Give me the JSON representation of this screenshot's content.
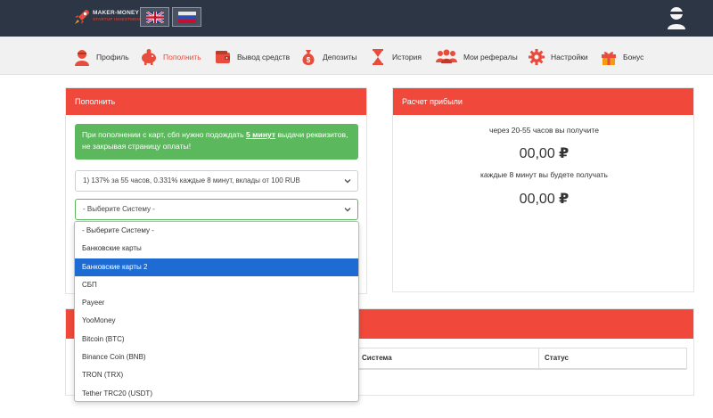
{
  "brand": {
    "name": "MAKER-MONEY",
    "tagline": "STARTUP INVESTMENTS"
  },
  "languages": [
    {
      "code": "en",
      "icon": "uk-flag-icon"
    },
    {
      "code": "ru",
      "icon": "ru-flag-icon"
    }
  ],
  "nav": {
    "items": [
      {
        "label": "Профиль",
        "icon": "user-icon"
      },
      {
        "label": "Пополнить",
        "icon": "piggy-bank-icon",
        "active": true
      },
      {
        "label": "Вывод средств",
        "icon": "wallet-icon"
      },
      {
        "label": "Депозиты",
        "icon": "money-bag-icon"
      },
      {
        "label": "История",
        "icon": "hourglass-icon"
      },
      {
        "label": "Мои рефералы",
        "icon": "people-icon"
      },
      {
        "label": "Настройки",
        "icon": "gear-icon"
      },
      {
        "label": "Бонус",
        "icon": "gift-icon"
      }
    ]
  },
  "deposit": {
    "title": "Пополнить",
    "alert_prefix": "При пополнении с карт, сбп нужно подождать ",
    "alert_bold": "5 минут",
    "alert_suffix": " выдачи реквизитов, не закрывая страницу оплаты!",
    "tariff_value": "1) 137% за 55 часов, 0.331% каждые 8 минут, вклады от 100 RUB",
    "system_value": "- Выберите Систему -",
    "system_options": [
      "- Выберите Систему -",
      "Банковские карты",
      "Банковские карты 2",
      "СБП",
      "Payeer",
      "YooMoney",
      "Bitcoin (BTC)",
      "Binance Coin (BNB)",
      "TRON (TRX)",
      "Tether TRC20 (USDT)"
    ],
    "system_selected_index": 2
  },
  "profit": {
    "title": "Расчет прибыли",
    "line1": "через 20-55 часов вы получите",
    "amount1": "00,00",
    "line2": "каждые 8 минут вы будете получать",
    "amount2": "00,00",
    "currency": "₽"
  },
  "history": {
    "columns": [
      "",
      "Система",
      "Статус"
    ]
  },
  "colors": {
    "topbar": "#2c3644",
    "accent": "#f0483a",
    "success": "#5cb85c",
    "selected": "#1e6cd3"
  }
}
